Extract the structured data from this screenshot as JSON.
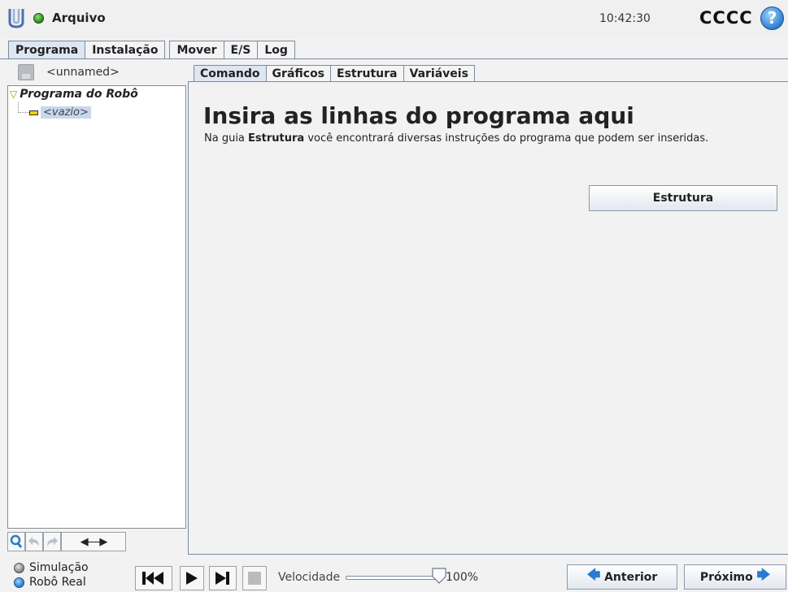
{
  "titlebar": {
    "app_title": "Arquivo",
    "time": "10:42:30",
    "robot_name": "CCCC",
    "help_symbol": "?",
    "logo_icon": "ur-logo-icon",
    "status_color": "#2e8c1f"
  },
  "top_tabs": [
    {
      "label": "Programa",
      "active": true
    },
    {
      "label": "Instalação",
      "active": false
    },
    {
      "label": "Mover",
      "active": false
    },
    {
      "label": "E/S",
      "active": false
    },
    {
      "label": "Log",
      "active": false
    }
  ],
  "program": {
    "name": "<unnamed>",
    "tree_root": "Programa do Robô",
    "tree_child": "<vazio>"
  },
  "left_toolbar": {
    "swap_label": "◀----▶"
  },
  "sub_tabs": [
    {
      "label": "Comando",
      "active": true
    },
    {
      "label": "Gráficos",
      "active": false
    },
    {
      "label": "Estrutura",
      "active": false
    },
    {
      "label": "Variáveis",
      "active": false
    }
  ],
  "main": {
    "heading": "Insira as linhas do programa aqui",
    "desc_prefix": "Na guia ",
    "desc_bold": "Estrutura",
    "desc_suffix": " você encontrará diversas instruções do programa que podem ser inseridas.",
    "structure_button": "Estrutura"
  },
  "footer": {
    "mode_simulation": "Simulação",
    "mode_real": "Robô Real",
    "speed_label": "Velocidade",
    "speed_value": "100%",
    "speed_fraction": 1.0,
    "prev_label": "Anterior",
    "next_label": "Próximo"
  },
  "colors": {
    "accent_blue": "#2f7fd0",
    "tab_active": "#dde6f1",
    "border": "#7a8ba0"
  }
}
